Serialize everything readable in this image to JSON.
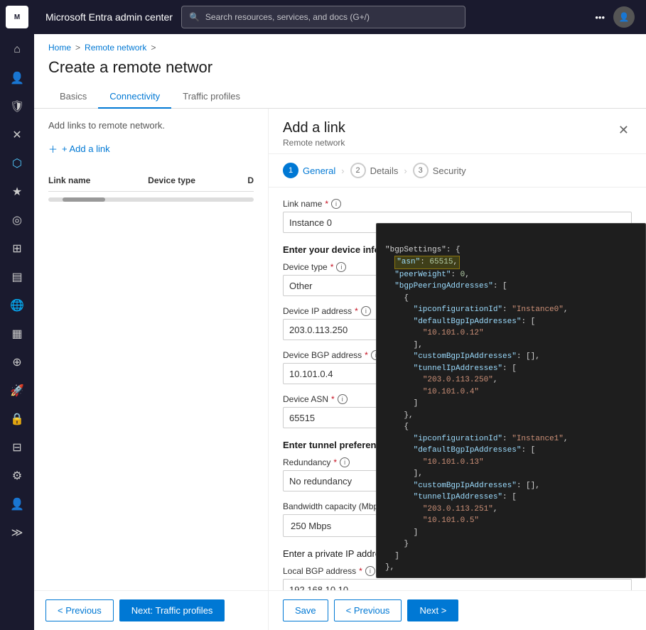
{
  "app": {
    "title": "Microsoft Entra admin center",
    "search_placeholder": "Search resources, services, and docs (G+/)"
  },
  "sidebar": {
    "icons": [
      {
        "name": "home-icon",
        "symbol": "⌂"
      },
      {
        "name": "users-icon",
        "symbol": "👤"
      },
      {
        "name": "shield-icon",
        "symbol": "🛡"
      },
      {
        "name": "cross-icon",
        "symbol": "✕"
      },
      {
        "name": "apps-icon",
        "symbol": "⬡"
      },
      {
        "name": "star-icon",
        "symbol": "★"
      },
      {
        "name": "identity-icon",
        "symbol": "◎"
      },
      {
        "name": "groups-icon",
        "symbol": "⊞"
      },
      {
        "name": "devices-icon",
        "symbol": "▤"
      },
      {
        "name": "globe-icon",
        "symbol": "🌐"
      },
      {
        "name": "chart-icon",
        "symbol": "▦"
      },
      {
        "name": "workflow-icon",
        "symbol": "⊕"
      },
      {
        "name": "rocket-icon",
        "symbol": "🚀"
      },
      {
        "name": "lock-icon",
        "symbol": "🔒"
      },
      {
        "name": "table-icon",
        "symbol": "⊟"
      },
      {
        "name": "gear-icon",
        "symbol": "⚙"
      },
      {
        "name": "person-icon",
        "symbol": "👤"
      },
      {
        "name": "expand-icon",
        "symbol": "≫"
      }
    ]
  },
  "breadcrumb": {
    "home": "Home",
    "remote_network": "Remote network",
    "separator": ">"
  },
  "page": {
    "title": "Create a remote networ",
    "add_link_text": "Add links to remote network."
  },
  "tabs": {
    "items": [
      {
        "label": "Basics",
        "active": false
      },
      {
        "label": "Connectivity",
        "active": true
      },
      {
        "label": "Traffic profiles",
        "active": false
      }
    ]
  },
  "links_table": {
    "columns": [
      "Link name",
      "Device type",
      "D"
    ],
    "add_button": "+ Add a link"
  },
  "footer_left": {
    "previous_label": "< Previous",
    "next_label": "Next: Traffic profiles"
  },
  "dialog": {
    "title": "Add a link",
    "subtitle": "Remote network",
    "close_label": "✕",
    "steps": [
      {
        "number": "1",
        "label": "General",
        "active": true
      },
      {
        "number": "2",
        "label": "Details",
        "active": false
      },
      {
        "number": "3",
        "label": "Security",
        "active": false
      }
    ],
    "form": {
      "link_name_label": "Link name",
      "link_name_required": "*",
      "link_name_value": "Instance 0",
      "device_info_section": "Enter your device info",
      "device_type_label": "Device type",
      "device_type_required": "*",
      "device_type_value": "Other",
      "device_ip_label": "Device IP address",
      "device_ip_required": "*",
      "device_ip_value": "203.0.113.250",
      "device_bgp_label": "Device BGP address",
      "device_bgp_required": "*",
      "device_bgp_value": "10.101.0.4",
      "device_asn_label": "Device ASN",
      "device_asn_required": "*",
      "device_asn_value": "65515",
      "tunnel_section": "Enter tunnel preference",
      "redundancy_label": "Redundancy",
      "redundancy_required": "*",
      "redundancy_value": "No redundancy",
      "bandwidth_label": "Bandwidth capacity (Mbps)",
      "bandwidth_required": "*",
      "bandwidth_value": "250 Mbps",
      "private_ip_section": "Enter a private IP address you want to use for Microsoft gateway",
      "local_bgp_label": "Local BGP address",
      "local_bgp_required": "*",
      "local_bgp_value": "192.168.10.10"
    },
    "footer": {
      "save_label": "Save",
      "previous_label": "< Previous",
      "next_label": "Next >"
    }
  },
  "json_content": {
    "lines": [
      "\"bgpSettings\": {",
      "  \"asn\": 65515,",
      "  \"peerWeight\": 0,",
      "  \"bgpPeeringAddresses\": [",
      "    {",
      "      \"ipconfigurationId\": \"Instance0\",",
      "      \"defaultBgpIpAddresses\": [",
      "        \"10.101.0.12\"",
      "      ],",
      "      \"customBgpIpAddresses\": [],",
      "      \"tunnelIpAddresses\": [",
      "        \"203.0.113.250\",",
      "        \"10.101.0.4\"",
      "      ]",
      "    },",
      "    {",
      "      \"ipconfigurationId\": \"Instance1\",",
      "      \"defaultBgpIpAddresses\": [",
      "        \"10.101.0.13\"",
      "      ],",
      "      \"customBgpIpAddresses\": [],",
      "      \"tunnelIpAddresses\": [",
      "        \"203.0.113.251\",",
      "        \"10.101.0.5\"",
      "      ]",
      "    }",
      "  ]",
      "},"
    ]
  }
}
